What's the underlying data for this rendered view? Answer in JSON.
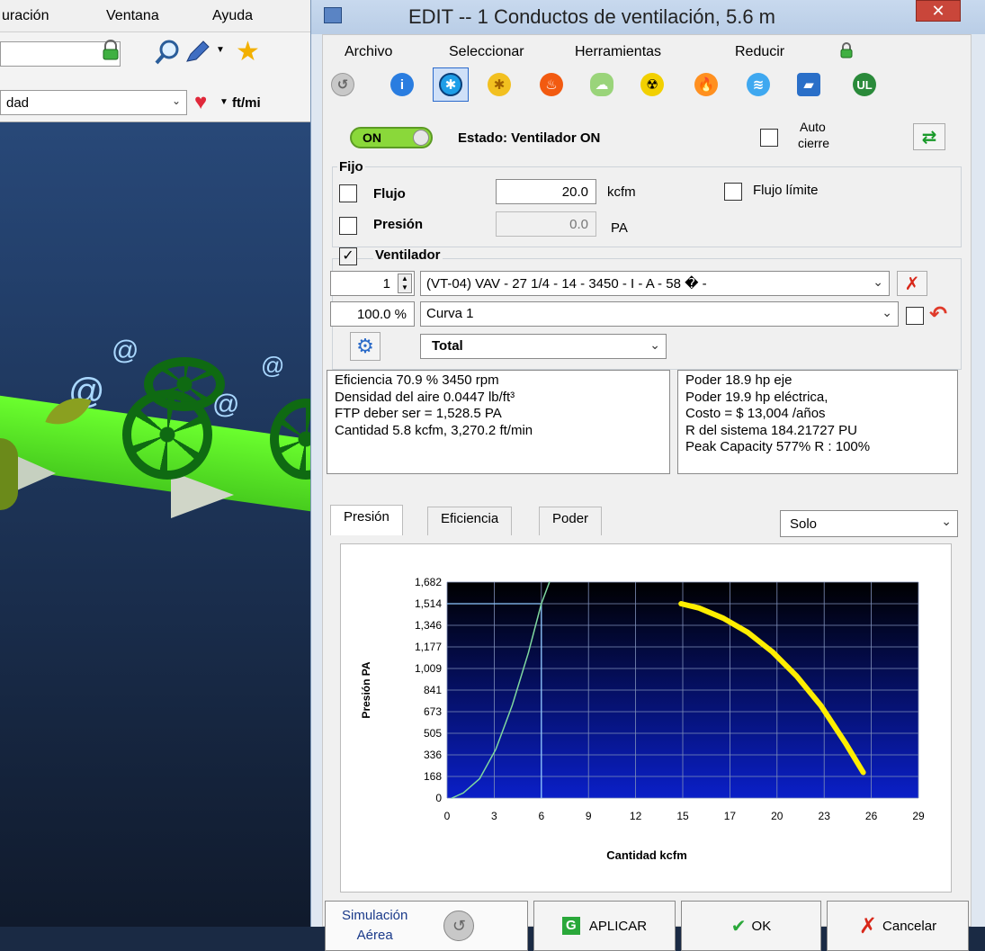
{
  "background_app": {
    "menu": [
      "uración",
      "Ventana",
      "Ayuda"
    ],
    "combo1_text": "",
    "combo2_text": "dad",
    "unit_label": "ft/mi"
  },
  "dialog": {
    "title": "EDIT -- 1 Conductos de ventilación, 5.6 m",
    "close_label": "✕",
    "menu": [
      "Archivo",
      "Seleccionar",
      "Herramientas",
      "Reducir"
    ],
    "toolbar_icons": [
      "circle-arrow-icon",
      "info-icon",
      "fan-icon",
      "sun-fan-icon",
      "fire-icon",
      "cloud-icon",
      "radiation-icon",
      "flame-icon",
      "wifi-icon",
      "book-icon",
      "ul-icon"
    ],
    "status": {
      "toggle_label": "ON",
      "status_text": "Estado: Ventilador ON",
      "auto_close_line1": "Auto",
      "auto_close_line2": "cierre"
    },
    "fixed": {
      "group_label": "Fijo",
      "flow_label": "Flujo",
      "flow_value": "20.0",
      "flow_unit": "kcfm",
      "flow_limit_label": "Flujo límite",
      "pressure_label": "Presión",
      "pressure_value": "0.0",
      "pressure_unit": "PA"
    },
    "fan": {
      "group_label": "Ventilador",
      "checked_mark": "✓",
      "count_value": "1",
      "model": "(VT-04) VAV  -  27 1/4  -  14  -  3450 - I - A -  58 � -",
      "percent": "100.0 %",
      "curve": "Curva 1",
      "mode": "Total"
    },
    "info_left": [
      "Eficiencia 70.9 %  3450 rpm",
      "Densidad del aire 0.0447 lb/ft³",
      "FTP deber ser = 1,528.5 PA",
      "Cantidad 5.8 kcfm, 3,270.2 ft/min"
    ],
    "info_right": [
      "Poder 18.9 hp eje",
      "Poder 19.9 hp eléctrica,",
      "Costo = $ 13,004 /años",
      "R del sistema 184.21727 PU",
      "Peak Capacity 577% R : 100%"
    ],
    "tabs": [
      "Presión",
      "Eficiencia",
      "Poder"
    ],
    "view_select": "Solo",
    "buttons": {
      "sim_line1": "Simulación",
      "sim_line2": "Aérea",
      "apply": "APLICAR",
      "apply_letter": "G",
      "ok": "OK",
      "cancel": "Cancelar"
    }
  },
  "chart_data": {
    "type": "line",
    "xlabel": "Cantidad kcfm",
    "ylabel": "Presión PA",
    "x_ticks": [
      "0",
      "3",
      "6",
      "9",
      "12",
      "15",
      "17",
      "20",
      "23",
      "26",
      "29"
    ],
    "y_ticks": [
      "0",
      "168",
      "336",
      "505",
      "673",
      "841",
      "1,009",
      "1,177",
      "1,346",
      "1,514",
      "1,682"
    ],
    "xlim": [
      0,
      29
    ],
    "ylim": [
      0,
      1682
    ],
    "grid": true,
    "series": [
      {
        "color": "#ffee00",
        "values": [
          [
            14.4,
            1514
          ],
          [
            15.5,
            1480
          ],
          [
            17,
            1400
          ],
          [
            18.5,
            1290
          ],
          [
            20,
            1140
          ],
          [
            21.5,
            950
          ],
          [
            23,
            720
          ],
          [
            24.5,
            430
          ],
          [
            25.6,
            200
          ]
        ]
      },
      {
        "color": "#7fd8a0",
        "values": [
          [
            0.3,
            0
          ],
          [
            1,
            40
          ],
          [
            2,
            150
          ],
          [
            3,
            380
          ],
          [
            4,
            720
          ],
          [
            5,
            1130
          ],
          [
            5.8,
            1514
          ],
          [
            6.3,
            1682
          ]
        ]
      }
    ],
    "operating_point": {
      "x": 5.8,
      "y": 1514
    },
    "colors": {
      "plot_bg_top": "#000000",
      "plot_bg_bottom": "#0a1fc8",
      "grid": "#7f8fb8",
      "marker_line": "#8fc8ff"
    }
  }
}
